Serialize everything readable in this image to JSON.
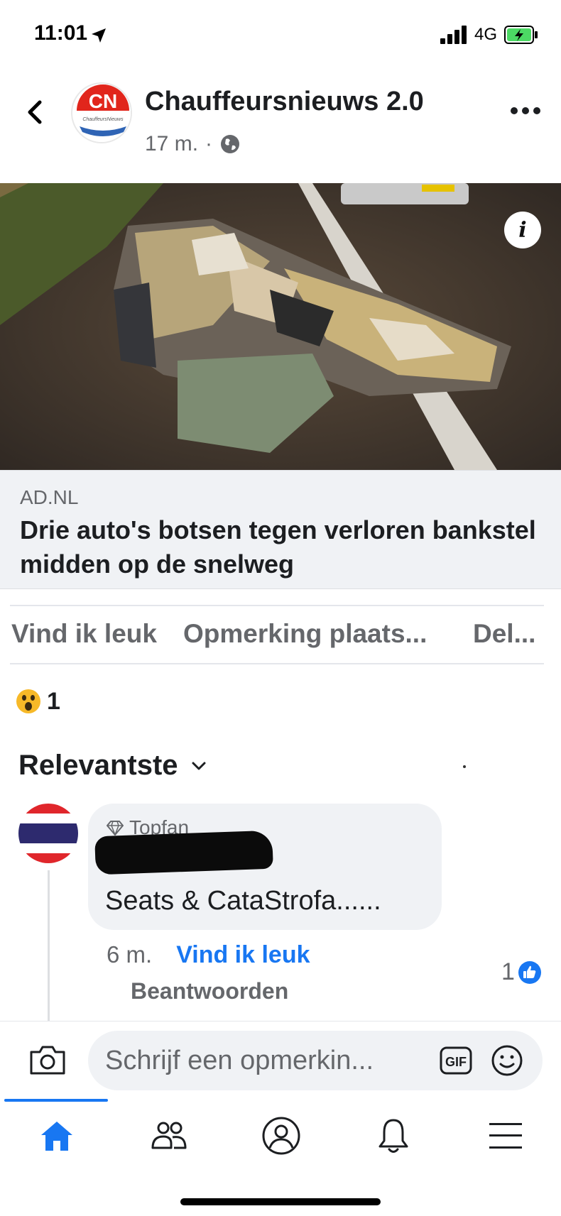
{
  "status_bar": {
    "time": "11:01",
    "network": "4G"
  },
  "post": {
    "page_name": "Chauffeursnieuws 2.0",
    "time_ago": "17 m.",
    "separator": "·",
    "logo": {
      "initials": "CN",
      "tagline": "ChauffeursNieuws"
    },
    "link": {
      "domain": "AD.NL",
      "title": "Drie auto's botsen tegen verloren bankstel midden op de snelweg"
    }
  },
  "actions": {
    "like": "Vind ik leuk",
    "comment": "Opmerking plaats...",
    "share": "Del..."
  },
  "reactions": {
    "icon": "wow-emoji",
    "count": "1"
  },
  "comments_sort": {
    "label": "Relevantste"
  },
  "comment": {
    "badge": "Topfan",
    "text": "Seats & CataStrofa......",
    "time_ago": "6 m.",
    "like_label": "Vind ik leuk",
    "reply_label": "Beantwoorden",
    "like_count": "1"
  },
  "composer": {
    "placeholder": "Schrijf een opmerkin..."
  },
  "colors": {
    "brand_blue": "#1877f2",
    "cn_red": "#e1261c",
    "secondary_text": "#65676b",
    "surface": "#f0f2f5"
  },
  "nav": {
    "items": [
      "home-icon",
      "friends-icon",
      "profile-icon",
      "bell-icon",
      "menu-icon"
    ]
  }
}
